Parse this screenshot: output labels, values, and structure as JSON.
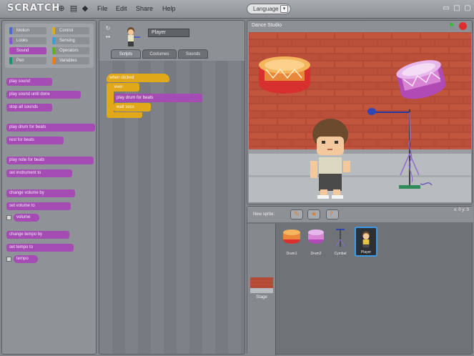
{
  "app": {
    "logo": "SCRATCH"
  },
  "menu": {
    "items": [
      "File",
      "Edit",
      "Share",
      "Help"
    ]
  },
  "toolbar": {
    "language": "Language"
  },
  "palette": {
    "categories": [
      {
        "label": "Motion",
        "color": "#4a6cd4"
      },
      {
        "label": "Control",
        "color": "#e1a91a"
      },
      {
        "label": "Looks",
        "color": "#8a55d7"
      },
      {
        "label": "Sensing",
        "color": "#2ca5e2"
      },
      {
        "label": "Sound",
        "color": "#bb42c3"
      },
      {
        "label": "Operators",
        "color": "#5cb712"
      },
      {
        "label": "Pen",
        "color": "#0e9a6c"
      },
      {
        "label": "Variables",
        "color": "#ee7d16"
      }
    ],
    "blocks": [
      "play sound",
      "play sound until done",
      "stop all sounds",
      "play drum for beats",
      "rest for beats",
      "play note for beats",
      "set instrument to",
      "change volume by",
      "set volume to",
      "volume",
      "change tempo by",
      "set tempo to",
      "tempo"
    ]
  },
  "scripts": {
    "sprite_name": "Player",
    "tabs": [
      "Scripts",
      "Costumes",
      "Sounds"
    ],
    "blocks": [
      "when clicked",
      "forever",
      "play drum for beats",
      "wait secs"
    ]
  },
  "stage": {
    "title": "Dance Studio"
  },
  "sprites": {
    "new_sprite_label": "New sprite:",
    "coords": "x: 0  y: 0",
    "stage_label": "Stage",
    "tiles": [
      {
        "label": "Drum1"
      },
      {
        "label": "Drum2"
      },
      {
        "label": "Cymbal"
      },
      {
        "label": "Player"
      }
    ]
  }
}
